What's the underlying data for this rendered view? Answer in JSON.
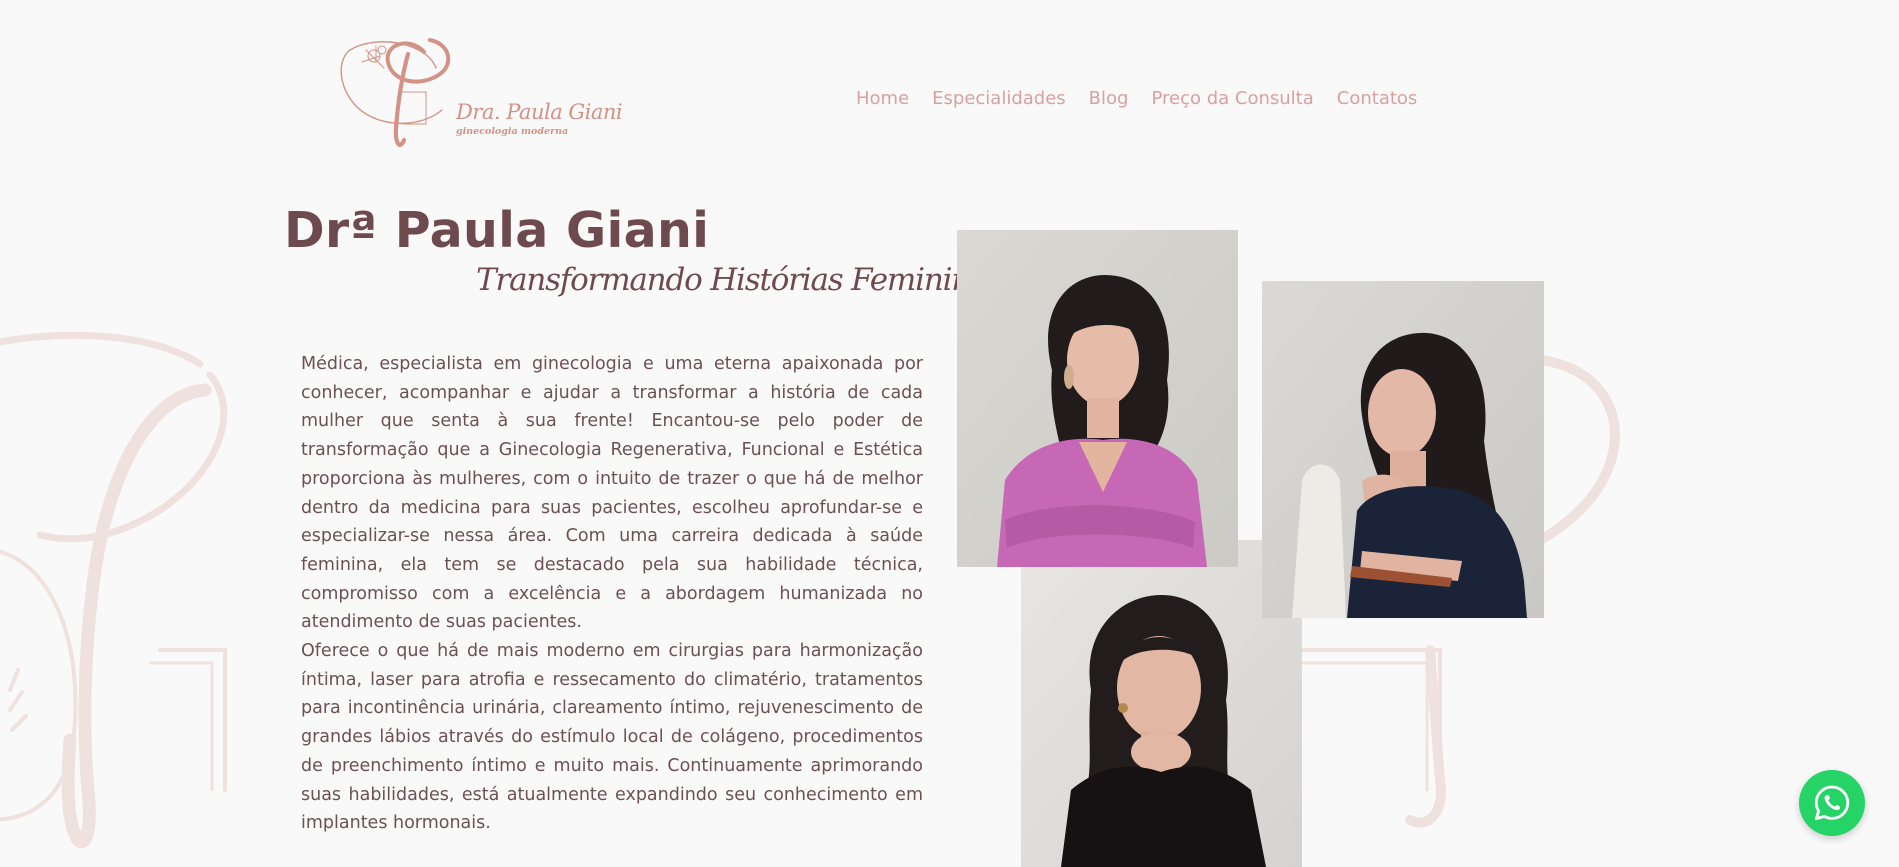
{
  "brand": {
    "name": "Dra. Paula Giani",
    "tagline": "ginecologia moderna"
  },
  "nav": {
    "items": [
      {
        "label": "Home"
      },
      {
        "label": "Especialidades"
      },
      {
        "label": "Blog"
      },
      {
        "label": "Preço da Consulta"
      },
      {
        "label": "Contatos"
      }
    ]
  },
  "hero": {
    "title": "Drª Paula Giani",
    "subtitle": "Transformando Histórias Femininas",
    "paragraphs": [
      "Médica, especialista em ginecologia e uma eterna apaixonada por conhecer, acompanhar e ajudar a transformar a história de cada mulher que senta à sua frente! Encantou-se pelo poder de transformação que a Ginecologia Regenerativa, Funcional e Estética proporciona às mulheres, com o intuito de trazer o que há de melhor dentro da medicina para suas pacientes, escolheu aprofundar-se e especializar-se nessa área. Com uma carreira dedicada à saúde feminina, ela tem se destacado pela sua habilidade técnica, compromisso com a excelência e a abordagem humanizada no atendimento de suas pacientes.",
      "Oferece o que há de mais moderno em cirurgias para harmonização íntima, laser para atrofia e ressecamento do climatério, tratamentos para incontinência urinária, clareamento íntimo, rejuvenescimento de grandes lábios através do estímulo local de colágeno, procedimentos de preenchimento íntimo e muito mais. Continuamente aprimorando suas habilidades, está atualmente expandindo seu conhecimento em implantes hormonais."
    ]
  },
  "colors": {
    "accent": "#d8a0a0",
    "heading": "#6e4a4e",
    "body_text": "#6b5155",
    "background": "#faf9f9",
    "watermark": "#efe1de",
    "whatsapp": "#25d366"
  },
  "icons": {
    "logo": "pg-monogram-logo",
    "floating_button": "whatsapp-icon"
  }
}
